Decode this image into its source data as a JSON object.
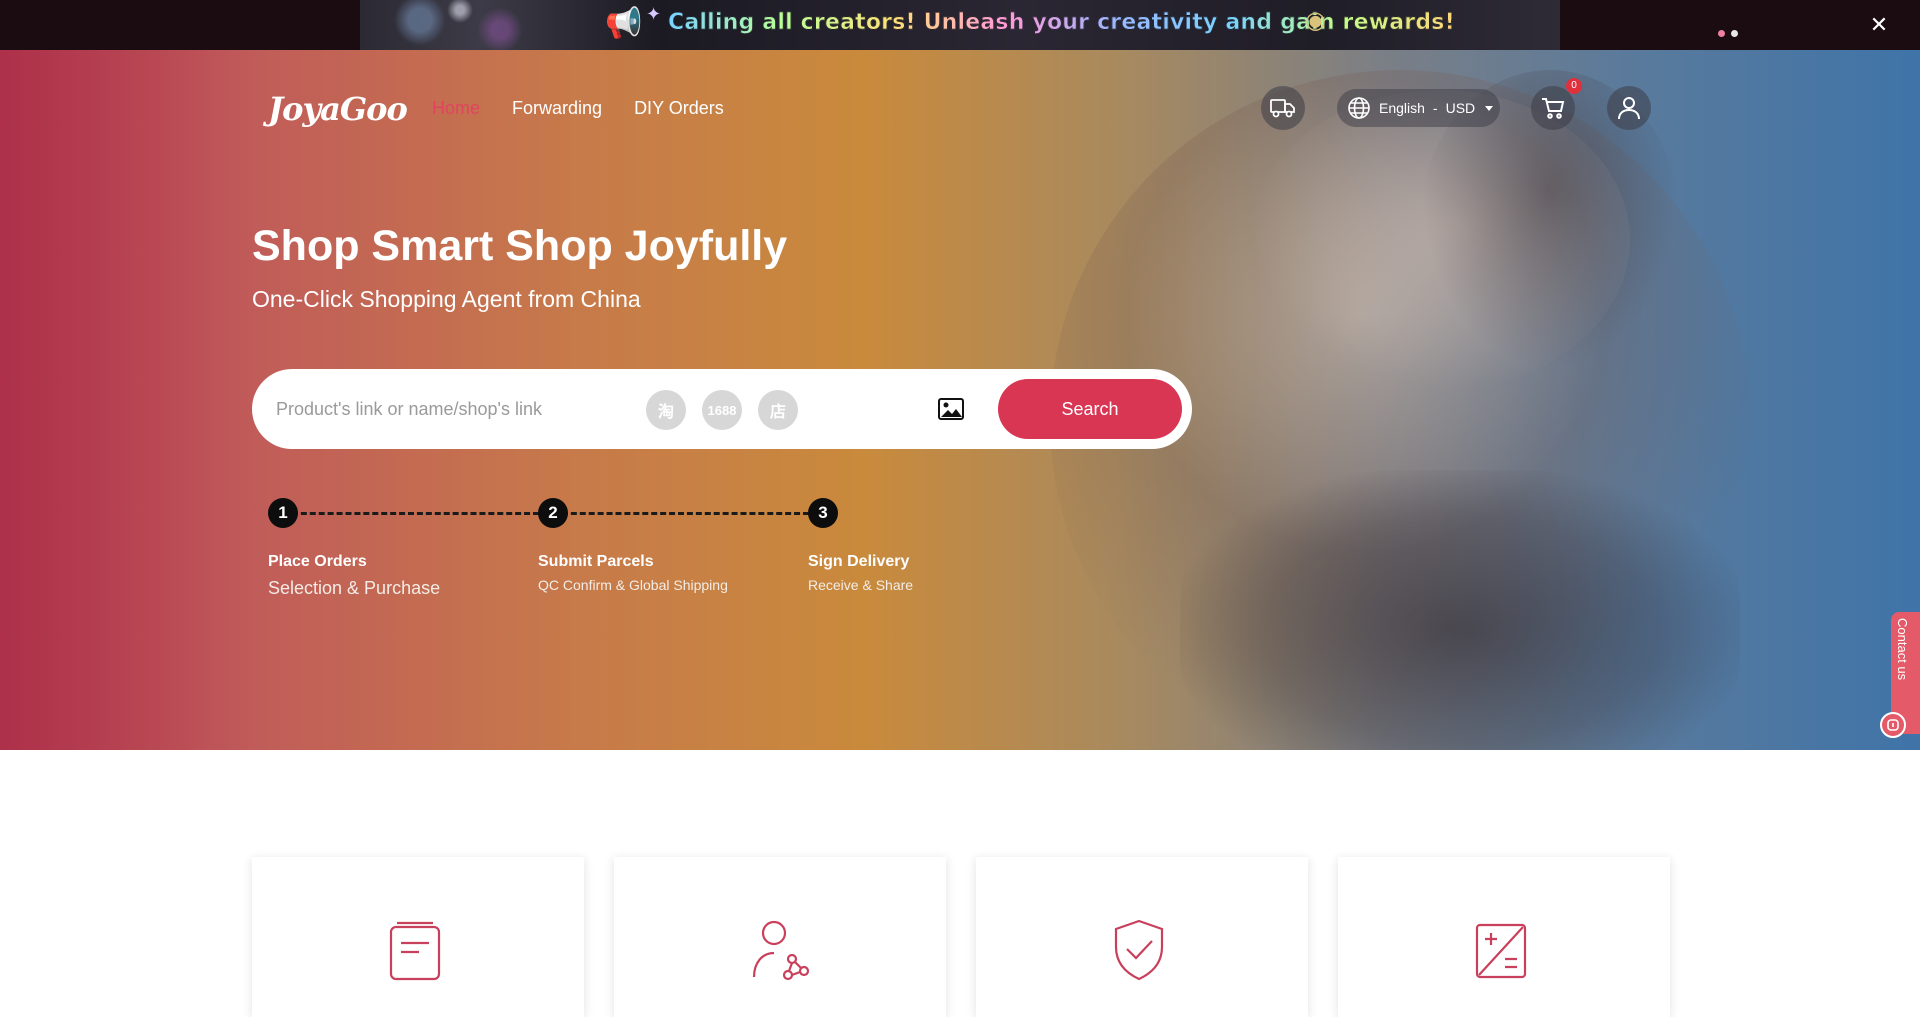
{
  "banner": {
    "text": "Calling all creators! Unleash your creativity and gain rewards!",
    "close_icon": "close-icon",
    "slides": 2,
    "active_slide": 1
  },
  "header": {
    "logo_text": "JoyaGoo",
    "nav": [
      {
        "label": "Home",
        "active": true
      },
      {
        "label": "Forwarding",
        "active": false
      },
      {
        "label": "DIY Orders",
        "active": false
      }
    ],
    "shipping_icon": "truck-icon",
    "language": "English",
    "currency": "USD",
    "lang_separator": "-",
    "cart_count": "0",
    "cart_icon": "cart-icon",
    "user_icon": "user-icon"
  },
  "hero": {
    "title": "Shop Smart Shop Joyfully",
    "subtitle": "One-Click Shopping Agent from China"
  },
  "search": {
    "placeholder": "Product's link or name/shop's link",
    "value": "",
    "sites": [
      "淘",
      "1688",
      "店"
    ],
    "image_search_icon": "image-icon",
    "button_label": "Search"
  },
  "steps": [
    {
      "number": "1",
      "title": "Place Orders",
      "desc": "Selection & Purchase"
    },
    {
      "number": "2",
      "title": "Submit Parcels",
      "desc": "QC Confirm & Global Shipping"
    },
    {
      "number": "3",
      "title": "Sign Delivery",
      "desc": "Receive & Share"
    }
  ],
  "contact": {
    "label": "Contact us"
  },
  "features": [
    {
      "icon": "document-icon"
    },
    {
      "icon": "user-network-icon"
    },
    {
      "icon": "shield-check-icon"
    },
    {
      "icon": "calculator-icon"
    }
  ],
  "colors": {
    "accent": "#d93654",
    "nav_active": "#e0445e",
    "badge": "#e0303c"
  }
}
